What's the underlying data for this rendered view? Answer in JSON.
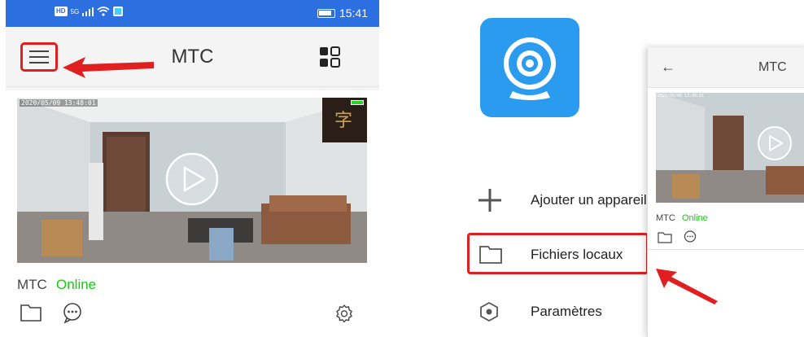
{
  "left_screen": {
    "status_bar": {
      "hd_badge": "HD",
      "network": "5G",
      "time": "15:41"
    },
    "app_bar": {
      "title": "MTC"
    },
    "device_card": {
      "timestamp": "2020/05/09 13:48:01",
      "name": "MTC",
      "status": "Online",
      "status_color": "#18c718"
    }
  },
  "right_screen": {
    "drawer_items": [
      {
        "label": "Ajouter un appareil",
        "icon": "plus-icon"
      },
      {
        "label": "Fichiers locaux",
        "icon": "folder-icon"
      },
      {
        "label": "Paramètres",
        "icon": "hexagon-settings-icon"
      }
    ],
    "panel": {
      "title": "MTC",
      "timestamp": "2020/05/09 13:48:01",
      "device_name": "MTC",
      "device_status": "Online"
    }
  },
  "colors": {
    "accent_blue": "#2b6fe0",
    "highlight_red": "#e02020",
    "online_green": "#18c718",
    "app_icon_blue": "#2a9bef"
  }
}
